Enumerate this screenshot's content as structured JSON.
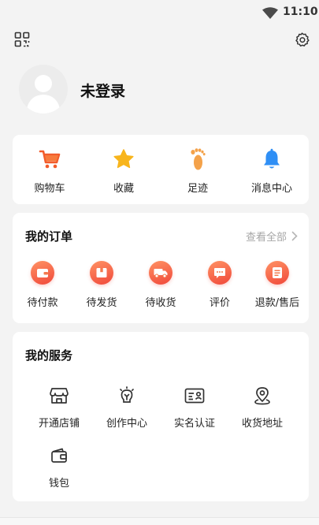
{
  "status_bar": {
    "time": "11:10",
    "icons": [
      "wifi-icon"
    ]
  },
  "header": {
    "icons": [
      "qr-code-icon",
      "settings-icon"
    ]
  },
  "profile": {
    "login_label": "未登录",
    "avatar_icon": "default-avatar-icon"
  },
  "quick_actions": [
    {
      "label": "购物车",
      "icon": "shopping-cart-icon",
      "color": "#f25b2a"
    },
    {
      "label": "收藏",
      "icon": "star-icon",
      "color": "#f7b21f"
    },
    {
      "label": "足迹",
      "icon": "footprint-icon",
      "color": "#f4a24a"
    },
    {
      "label": "消息中心",
      "icon": "bell-icon",
      "color": "#2f8ff5"
    }
  ],
  "orders": {
    "title": "我的订单",
    "view_all": "查看全部",
    "items": [
      {
        "label": "待付款",
        "icon": "wallet-icon"
      },
      {
        "label": "待发货",
        "icon": "package-icon"
      },
      {
        "label": "待收货",
        "icon": "truck-icon"
      },
      {
        "label": "评价",
        "icon": "comment-icon"
      },
      {
        "label": "退款/售后",
        "icon": "refund-icon"
      }
    ],
    "accent": "#f0483a"
  },
  "services": {
    "title": "我的服务",
    "items": [
      {
        "label": "开通店铺",
        "icon": "store-icon"
      },
      {
        "label": "创作中心",
        "icon": "lightbulb-icon"
      },
      {
        "label": "实名认证",
        "icon": "id-card-icon"
      },
      {
        "label": "收货地址",
        "icon": "location-icon"
      },
      {
        "label": "钱包",
        "icon": "wallet-outline-icon"
      }
    ]
  }
}
